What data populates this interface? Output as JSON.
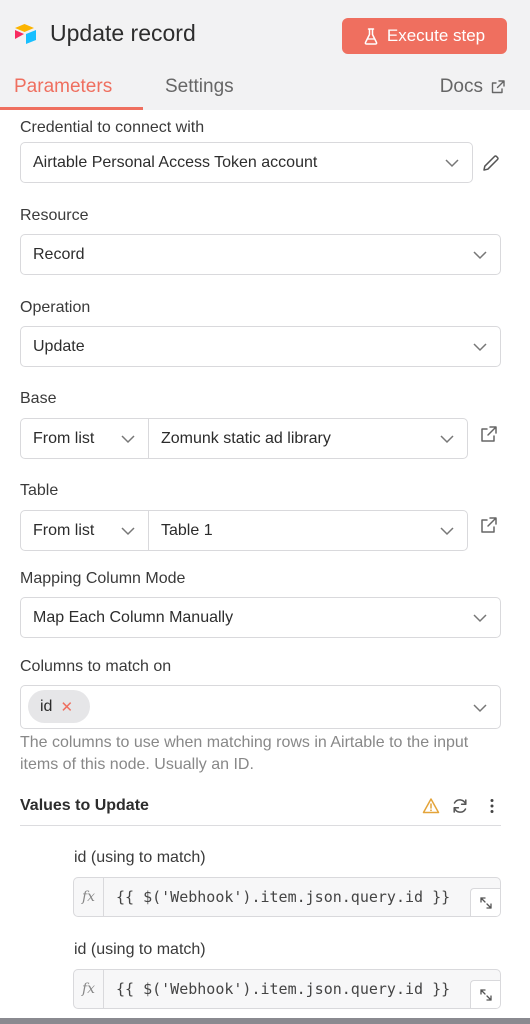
{
  "header": {
    "title": "Update record",
    "execute_label": "Execute step",
    "tabs": [
      {
        "label": "Parameters",
        "active": true
      },
      {
        "label": "Settings",
        "active": false
      }
    ],
    "docs_label": "Docs",
    "accent_color": "#ef6f5f"
  },
  "form": {
    "credential": {
      "label": "Credential to connect with",
      "value": "Airtable Personal Access Token account"
    },
    "resource": {
      "label": "Resource",
      "value": "Record"
    },
    "operation": {
      "label": "Operation",
      "value": "Update"
    },
    "base": {
      "label": "Base",
      "mode": "From list",
      "value": "Zomunk static ad library"
    },
    "table": {
      "label": "Table",
      "mode": "From list",
      "value": "Table 1"
    },
    "mapping_mode": {
      "label": "Mapping Column Mode",
      "value": "Map Each Column Manually"
    },
    "columns_to_match": {
      "label": "Columns to match on",
      "chips": [
        "id"
      ],
      "hint": "The columns to use when matching rows in Airtable to the input items of this node. Usually an ID."
    },
    "values_to_update": {
      "title": "Values to Update",
      "fields": [
        {
          "label": "id (using to match)",
          "fx": "fx",
          "expression": "{{ $('Webhook').item.json.query.id }}"
        },
        {
          "label": "id (using to match)",
          "fx": "fx",
          "expression": "{{ $('Webhook').item.json.query.id }}"
        }
      ]
    }
  },
  "icons": {
    "app": "airtable-logo-icon",
    "flask": "flask-icon",
    "external": "external-link-icon",
    "edit": "pencil-icon",
    "warning": "warning-icon",
    "refresh": "refresh-icon",
    "more": "more-vertical-icon"
  }
}
